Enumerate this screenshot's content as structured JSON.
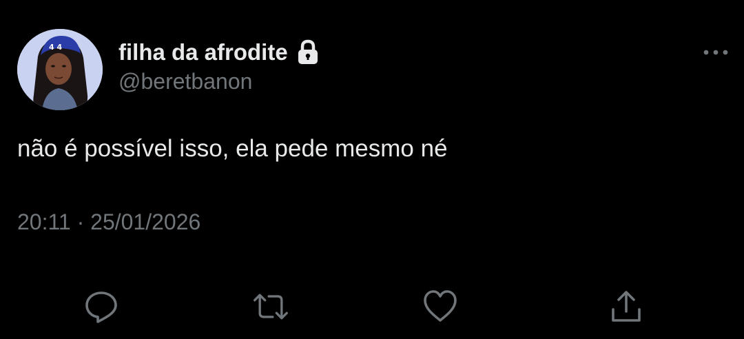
{
  "tweet": {
    "author": {
      "display_name": "filha da afrodite",
      "handle": "@beretbanon",
      "protected_icon": "lock-icon",
      "avatar": "profile-photo"
    },
    "text": "não é possível isso, ela pede mesmo né",
    "timestamp": "20:11 · 25/01/2026",
    "more_icon": "more-horizontal-icon"
  },
  "actions": [
    {
      "name": "reply",
      "icon": "comment-bubble-icon"
    },
    {
      "name": "retweet",
      "icon": "retweet-arrows-icon"
    },
    {
      "name": "like",
      "icon": "heart-icon"
    },
    {
      "name": "share",
      "icon": "share-upload-icon"
    }
  ],
  "colors": {
    "background": "#000000",
    "primary_text": "#e7e9ea",
    "secondary_text": "#71767b"
  }
}
